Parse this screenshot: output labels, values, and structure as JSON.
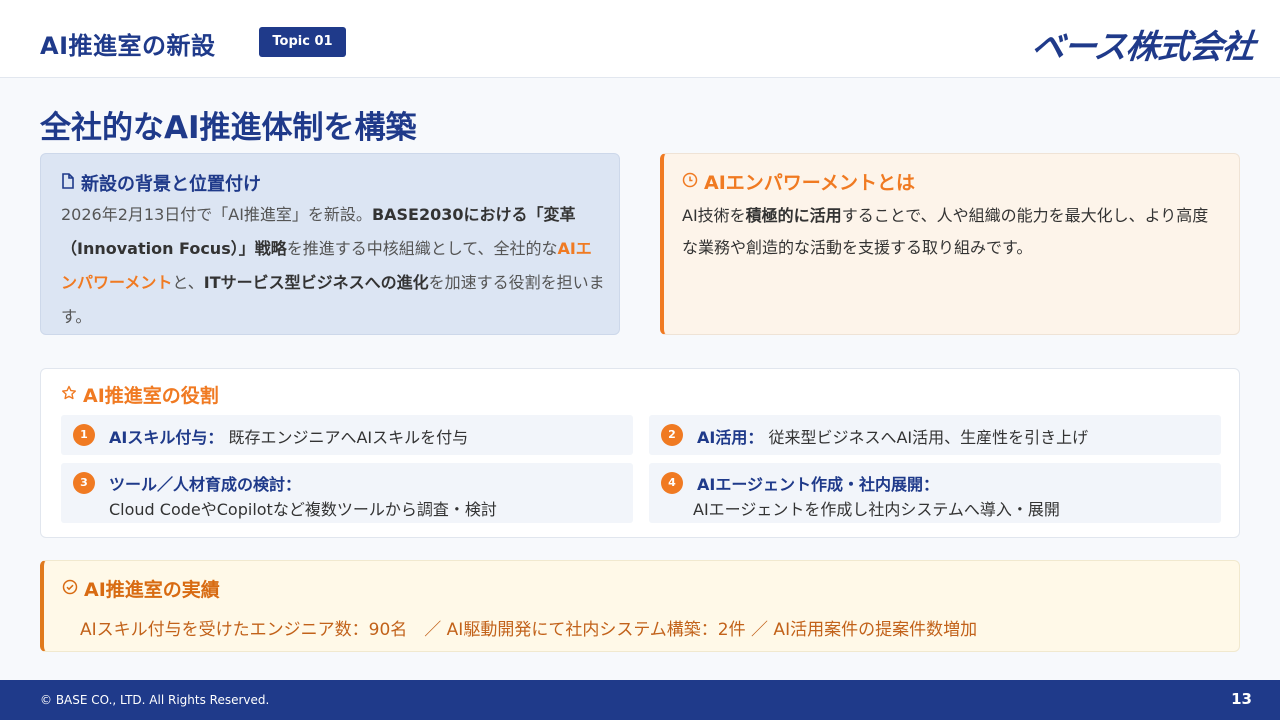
{
  "header": {
    "title": "AI推進室の新設",
    "topic": "Topic 01",
    "logo": "ベース株式会社"
  },
  "main_title": "全社的なAI推進体制を構築",
  "background_card": {
    "title": "新設の背景と位置付け",
    "icon": "document-icon",
    "t1": "2026年2月13日付で「AI推進室」を新設。",
    "t2": "BASE2030における「変革（Innovation Focus）」戦略",
    "t3": "を推進する中核組織として、全社的な",
    "t4": "AIエンパワーメント",
    "t5": "と、",
    "t6": "ITサービス型ビジネスへの進化",
    "t7": "を加速する役割を担います。"
  },
  "empowerment_card": {
    "title": "AIエンパワーメントとは",
    "icon": "clock-icon",
    "t1": "AI技術を",
    "t2": "積極的に活用",
    "t3": "することで、人や組織の能力を最大化し、より高度な業務や創造的な活動を支援する取り組みです。"
  },
  "roles_card": {
    "title": "AI推進室の役割",
    "icon": "star-icon",
    "items": [
      {
        "num": "1",
        "head": "AIスキル付与：",
        "text": "既存エンジニアへAIスキルを付与"
      },
      {
        "num": "2",
        "head": "AI活用：",
        "text": "従来型ビジネスへAI活用、生産性を引き上げ"
      },
      {
        "num": "3",
        "head": "ツール／人材育成の検討：",
        "text": "Cloud CodeやCopilotなど複数ツールから調査・検討"
      },
      {
        "num": "4",
        "head": "AIエージェント作成・社内展開：",
        "text": "AIエージェントを作成し社内システムへ導入・展開"
      }
    ]
  },
  "achievements_card": {
    "title": "AI推進室の実績",
    "icon": "check-circle-icon",
    "text": "AIスキル付与を受けたエンジニア数：90名　／ AI駆動開発にて社内システム構築：2件 ／ AI活用案件の提案件数増加"
  },
  "footer": {
    "copyright": "© BASE CO., LTD. All Rights Reserved.",
    "page": "13"
  },
  "colors": {
    "primary": "#1f3a8a",
    "accent": "#f07a22"
  }
}
